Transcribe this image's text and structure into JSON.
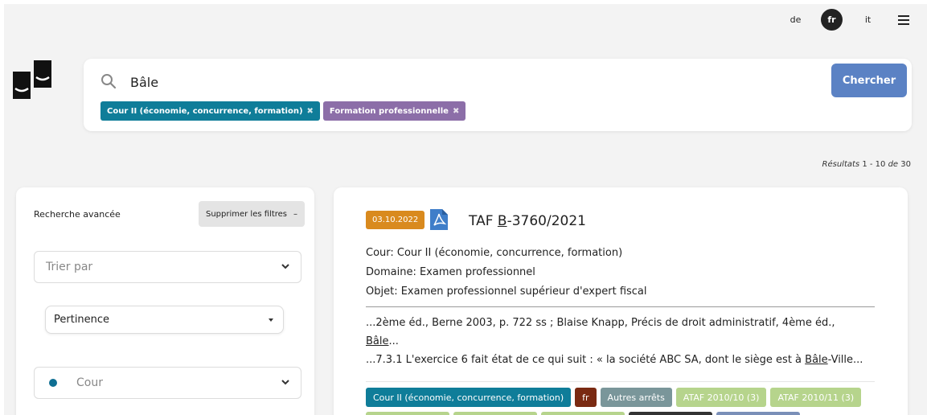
{
  "languages": [
    {
      "code": "de",
      "active": false
    },
    {
      "code": "fr",
      "active": true
    },
    {
      "code": "it",
      "active": false
    }
  ],
  "search": {
    "value": "Bâle",
    "button_label": "Chercher",
    "filters": [
      {
        "label": "Cour II (économie, concurrence, formation)",
        "color": "#0f7d99"
      },
      {
        "label": "Formation professionnelle",
        "color": "#8c6ea8"
      }
    ]
  },
  "results": {
    "label": "Résultats",
    "range": "1 - 10",
    "of_label": "de",
    "total": "30"
  },
  "sidebar": {
    "title": "Recherche avancée",
    "clear_label": "Supprimer les filtres",
    "sort_placeholder": "Trier par",
    "sort_value": "Pertinence",
    "court_label": "Cour"
  },
  "result": {
    "date": "03.10.2022",
    "title_prefix": "TAF ",
    "title_letter": "B",
    "title_suffix": "-3760/2021",
    "court_line": "Cour: Cour II (économie, concurrence, formation)",
    "domain_line": "Domaine: Examen professionnel",
    "object_line": "Objet: Examen professionnel supérieur d'expert fiscal",
    "excerpt1": "...2ème éd., Berne 2003, p. 722 ss ; Blaise Knapp, Précis de droit administratif, 4ème éd.,",
    "excerpt1_hl": "Bâle",
    "excerpt1_end": "...",
    "excerpt2_start": "...7.3.1 L'exercice 6 fait état de ce qui suit : « la société ABC SA, dont le siège est à ",
    "excerpt2_hl": "Bâle",
    "excerpt2_end": "-Ville...",
    "tags": [
      {
        "label": "Cour II (économie, concurrence, formation)",
        "color": "#0f7d99"
      },
      {
        "label": "fr",
        "color": "#7a2a12"
      },
      {
        "label": "Autres arrêts",
        "color": "#7a969a"
      },
      {
        "label": "ATAF 2010/10 (3)",
        "color": "#b6d48c"
      },
      {
        "label": "ATAF 2010/11 (3)",
        "color": "#b6d48c"
      }
    ],
    "tags_row2_colors": [
      "#b6d48c",
      "#b6d48c",
      "#b6d48c",
      "#333333",
      "#7a8fb8"
    ]
  }
}
